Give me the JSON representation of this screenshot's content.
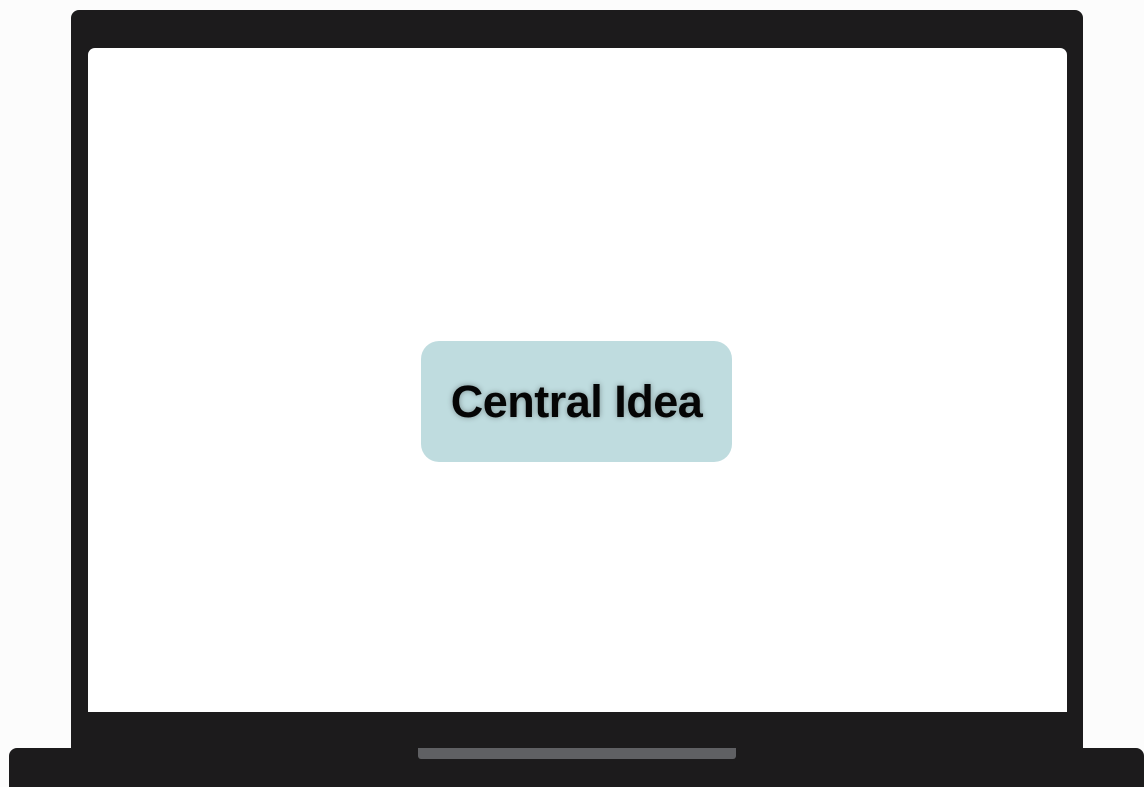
{
  "diagram": {
    "central_node": {
      "label": "Central Idea"
    }
  },
  "colors": {
    "device_body": "#1c1b1c",
    "screen": "#ffffff",
    "node_fill": "#bfdcdf",
    "trackpad_notch": "#5f6063",
    "background": "#fcfcfc"
  },
  "icons": {
    "device": "laptop-frame"
  }
}
